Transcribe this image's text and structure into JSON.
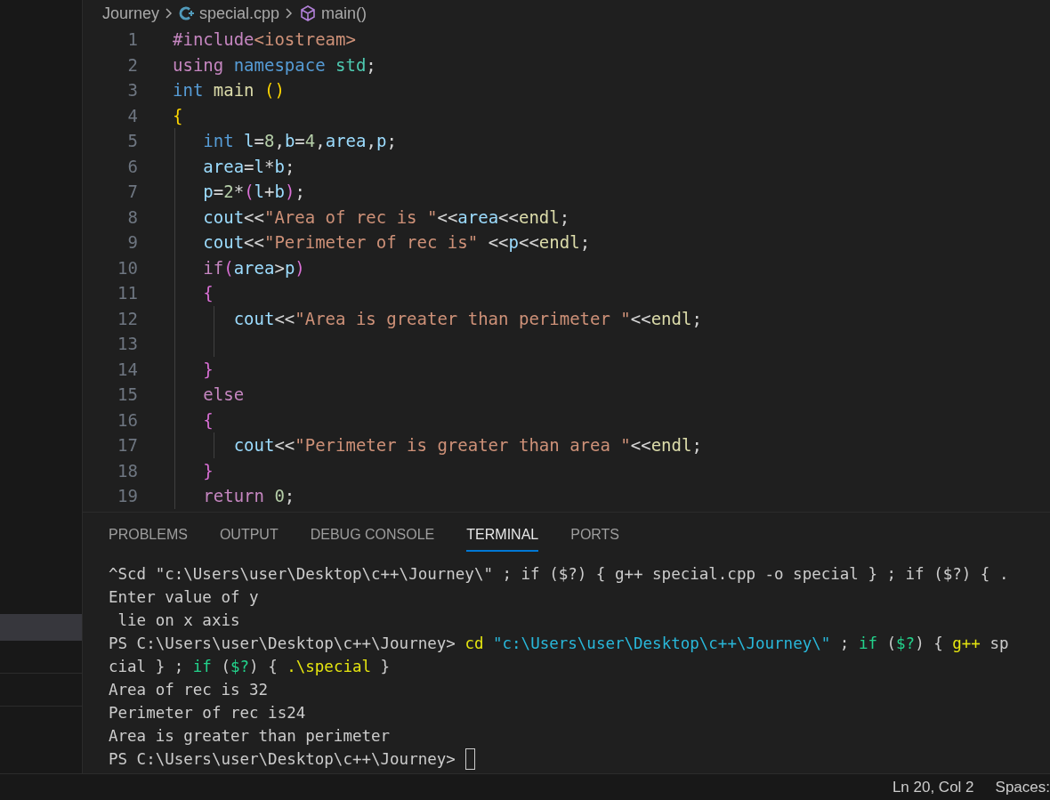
{
  "sidebar": {
    "items": [
      {
        "selected": true
      },
      {
        "selected": false
      },
      {
        "selected": false
      }
    ]
  },
  "breadcrumb": [
    {
      "kind": "folder",
      "label": "Journey"
    },
    {
      "kind": "file",
      "label": "special.cpp"
    },
    {
      "kind": "symbol",
      "label": "main()"
    }
  ],
  "editor": {
    "lines": [
      {
        "number": "1",
        "tokens": [
          {
            "kind": "preproc",
            "text": "#include"
          },
          {
            "kind": "include",
            "text": "<iostream>"
          }
        ]
      },
      {
        "number": "2",
        "tokens": [
          {
            "kind": "keyword",
            "text": "using"
          },
          {
            "kind": "storage",
            "text": " namespace"
          },
          {
            "kind": "ns",
            "text": " std"
          },
          {
            "kind": "op",
            "text": ";"
          }
        ]
      },
      {
        "number": "3",
        "tokens": [
          {
            "kind": "storage",
            "text": "int"
          },
          {
            "kind": "func",
            "text": " main"
          },
          {
            "kind": "bracket1",
            "text": " ()"
          }
        ]
      },
      {
        "number": "4",
        "tokens": [
          {
            "kind": "bracket1",
            "text": "{"
          }
        ]
      },
      {
        "number": "5",
        "tokens": [
          {
            "kind": "storage",
            "text": "   int"
          },
          {
            "kind": "var",
            "text": " l"
          },
          {
            "kind": "op",
            "text": "="
          },
          {
            "kind": "num",
            "text": "8"
          },
          {
            "kind": "op",
            "text": ","
          },
          {
            "kind": "var",
            "text": "b"
          },
          {
            "kind": "op",
            "text": "="
          },
          {
            "kind": "num",
            "text": "4"
          },
          {
            "kind": "op",
            "text": ","
          },
          {
            "kind": "var",
            "text": "area"
          },
          {
            "kind": "op",
            "text": ","
          },
          {
            "kind": "var",
            "text": "p"
          },
          {
            "kind": "op",
            "text": ";"
          }
        ]
      },
      {
        "number": "6",
        "tokens": [
          {
            "kind": "var",
            "text": "   area"
          },
          {
            "kind": "op",
            "text": "="
          },
          {
            "kind": "var",
            "text": "l"
          },
          {
            "kind": "op",
            "text": "*"
          },
          {
            "kind": "var",
            "text": "b"
          },
          {
            "kind": "op",
            "text": ";"
          }
        ]
      },
      {
        "number": "7",
        "tokens": [
          {
            "kind": "var",
            "text": "   p"
          },
          {
            "kind": "op",
            "text": "="
          },
          {
            "kind": "num",
            "text": "2"
          },
          {
            "kind": "op",
            "text": "*"
          },
          {
            "kind": "bracket2",
            "text": "("
          },
          {
            "kind": "var",
            "text": "l"
          },
          {
            "kind": "op",
            "text": "+"
          },
          {
            "kind": "var",
            "text": "b"
          },
          {
            "kind": "bracket2",
            "text": ")"
          },
          {
            "kind": "op",
            "text": ";"
          }
        ]
      },
      {
        "number": "8",
        "tokens": [
          {
            "kind": "var",
            "text": "   cout"
          },
          {
            "kind": "op",
            "text": "<<"
          },
          {
            "kind": "str",
            "text": "\"Area of rec is \""
          },
          {
            "kind": "op",
            "text": "<<"
          },
          {
            "kind": "var",
            "text": "area"
          },
          {
            "kind": "op",
            "text": "<<"
          },
          {
            "kind": "func",
            "text": "endl"
          },
          {
            "kind": "op",
            "text": ";"
          }
        ]
      },
      {
        "number": "9",
        "tokens": [
          {
            "kind": "var",
            "text": "   cout"
          },
          {
            "kind": "op",
            "text": "<<"
          },
          {
            "kind": "str",
            "text": "\"Perimeter of rec is\""
          },
          {
            "kind": "op",
            "text": " <<"
          },
          {
            "kind": "var",
            "text": "p"
          },
          {
            "kind": "op",
            "text": "<<"
          },
          {
            "kind": "func",
            "text": "endl"
          },
          {
            "kind": "op",
            "text": ";"
          }
        ]
      },
      {
        "number": "10",
        "tokens": [
          {
            "kind": "keyword",
            "text": "   if"
          },
          {
            "kind": "bracket2",
            "text": "("
          },
          {
            "kind": "var",
            "text": "area"
          },
          {
            "kind": "op",
            "text": ">"
          },
          {
            "kind": "var",
            "text": "p"
          },
          {
            "kind": "bracket2",
            "text": ")"
          }
        ]
      },
      {
        "number": "11",
        "tokens": [
          {
            "kind": "bracket2",
            "text": "   {"
          }
        ]
      },
      {
        "number": "12",
        "tokens": [
          {
            "kind": "var",
            "text": "      cout"
          },
          {
            "kind": "op",
            "text": "<<"
          },
          {
            "kind": "str",
            "text": "\"Area is greater than perimeter \""
          },
          {
            "kind": "op",
            "text": "<<"
          },
          {
            "kind": "func",
            "text": "endl"
          },
          {
            "kind": "op",
            "text": ";"
          }
        ]
      },
      {
        "number": "13"
      },
      {
        "number": "14",
        "tokens": [
          {
            "kind": "bracket2",
            "text": "   }"
          }
        ]
      },
      {
        "number": "15",
        "tokens": [
          {
            "kind": "keyword",
            "text": "   else"
          }
        ]
      },
      {
        "number": "16",
        "tokens": [
          {
            "kind": "bracket2",
            "text": "   {"
          }
        ]
      },
      {
        "number": "17",
        "tokens": [
          {
            "kind": "var",
            "text": "      cout"
          },
          {
            "kind": "op",
            "text": "<<"
          },
          {
            "kind": "str",
            "text": "\"Perimeter is greater than area \""
          },
          {
            "kind": "op",
            "text": "<<"
          },
          {
            "kind": "func",
            "text": "endl"
          },
          {
            "kind": "op",
            "text": ";"
          }
        ]
      },
      {
        "number": "18",
        "tokens": [
          {
            "kind": "bracket2",
            "text": "   }"
          }
        ]
      },
      {
        "number": "19",
        "tokens": [
          {
            "kind": "keyword",
            "text": "   return"
          },
          {
            "kind": "num",
            "text": " 0"
          },
          {
            "kind": "op",
            "text": ";"
          }
        ]
      }
    ]
  },
  "panel": {
    "tabs": [
      {
        "label": "PROBLEMS",
        "selected": false
      },
      {
        "label": "OUTPUT",
        "selected": false
      },
      {
        "label": "DEBUG CONSOLE",
        "selected": false
      },
      {
        "label": "TERMINAL",
        "selected": true
      },
      {
        "label": "PORTS",
        "selected": false
      }
    ],
    "terminal": [
      {
        "cursor": false,
        "tokens": [
          {
            "kind": "plain",
            "text": "^Scd \"c:\\Users\\user\\Desktop\\c++\\Journey\\\" ; if ($?) { g++ special.cpp -o special } ; if ($?) { ."
          }
        ]
      },
      {
        "cursor": false,
        "tokens": [
          {
            "kind": "plain",
            "text": "Enter value of y"
          }
        ]
      },
      {
        "cursor": false,
        "tokens": [
          {
            "kind": "plain",
            "text": " lie on x axis"
          }
        ]
      },
      {
        "cursor": false,
        "tokens": [
          {
            "kind": "plain",
            "text": "PS C:\\Users\\user\\Desktop\\c++\\Journey> "
          },
          {
            "kind": "cmd",
            "text": "cd"
          },
          {
            "kind": "str",
            "text": " \"c:\\Users\\user\\Desktop\\c++\\Journey\\\""
          },
          {
            "kind": "plain",
            "text": " ; "
          },
          {
            "kind": "kw",
            "text": "if"
          },
          {
            "kind": "plain",
            "text": " ("
          },
          {
            "kind": "kw",
            "text": "$?"
          },
          {
            "kind": "plain",
            "text": ") { "
          },
          {
            "kind": "cmd",
            "text": "g++"
          },
          {
            "kind": "plain",
            "text": " sp"
          }
        ]
      },
      {
        "cursor": false,
        "tokens": [
          {
            "kind": "plain",
            "text": "cial } ; "
          },
          {
            "kind": "kw",
            "text": "if"
          },
          {
            "kind": "plain",
            "text": " ("
          },
          {
            "kind": "kw",
            "text": "$?"
          },
          {
            "kind": "plain",
            "text": ") { "
          },
          {
            "kind": "cmd",
            "text": ".\\special"
          },
          {
            "kind": "plain",
            "text": " }"
          }
        ]
      },
      {
        "cursor": false,
        "tokens": [
          {
            "kind": "plain",
            "text": "Area of rec is 32"
          }
        ]
      },
      {
        "cursor": false,
        "tokens": [
          {
            "kind": "plain",
            "text": "Perimeter of rec is24"
          }
        ]
      },
      {
        "cursor": false,
        "tokens": [
          {
            "kind": "plain",
            "text": "Area is greater than perimeter"
          }
        ]
      },
      {
        "cursor": true,
        "tokens": [
          {
            "kind": "plain",
            "text": "PS C:\\Users\\user\\Desktop\\c++\\Journey> "
          }
        ]
      }
    ]
  },
  "status_bar": [
    {
      "text": "Ln 20, Col 2"
    },
    {
      "text": "Spaces:"
    }
  ]
}
